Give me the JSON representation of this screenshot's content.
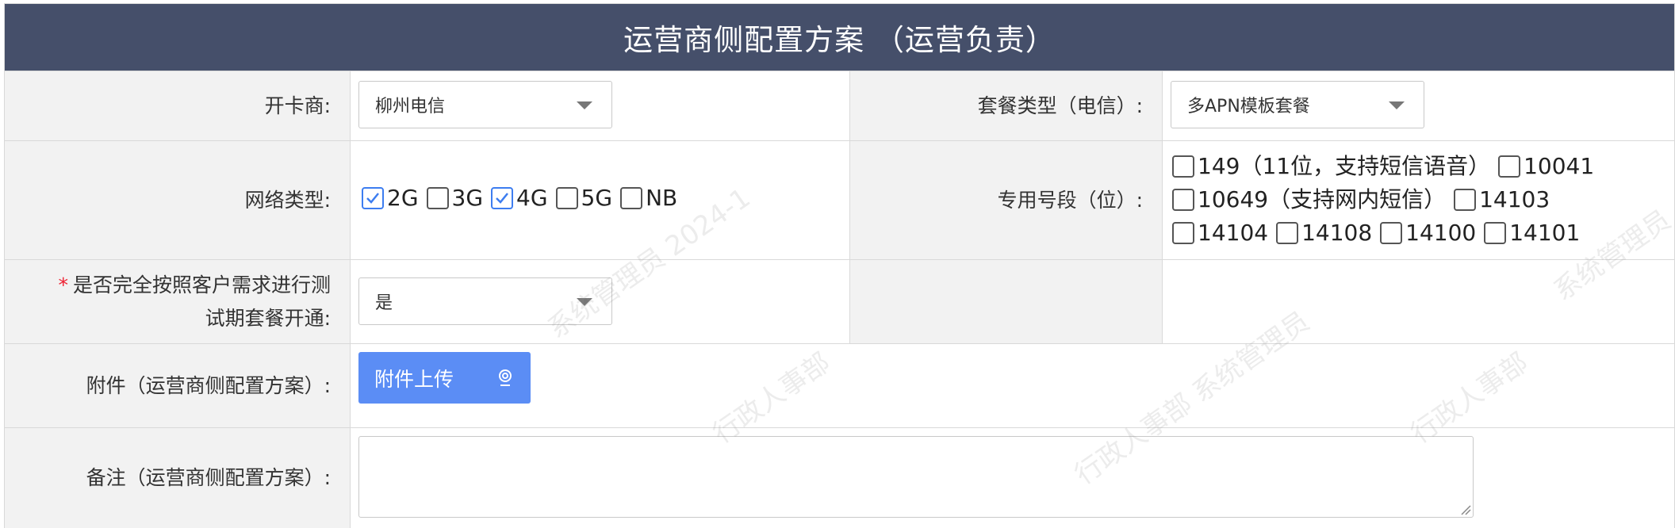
{
  "header": {
    "title": "运营商侧配置方案 （运营负责）"
  },
  "row1": {
    "card_vendor_label": "开卡商:",
    "card_vendor_value": "柳州电信",
    "plan_type_label": "套餐类型（电信）:",
    "plan_type_value": "多APN模板套餐"
  },
  "row2": {
    "network_label": "网络类型:",
    "networks": [
      {
        "label": "2G",
        "checked": true
      },
      {
        "label": "3G",
        "checked": false
      },
      {
        "label": "4G",
        "checked": true
      },
      {
        "label": "5G",
        "checked": false
      },
      {
        "label": "NB",
        "checked": false
      }
    ],
    "segment_label": "专用号段（位）:",
    "segments": [
      {
        "label": "149（11位，支持短信语音）",
        "checked": false
      },
      {
        "label": "10041",
        "checked": false
      },
      {
        "label": "10649（支持网内短信）",
        "checked": false
      },
      {
        "label": "14103",
        "checked": false
      },
      {
        "label": "14104",
        "checked": false
      },
      {
        "label": "14108",
        "checked": false
      },
      {
        "label": "14100",
        "checked": false
      },
      {
        "label": "14101",
        "checked": false
      }
    ]
  },
  "row3": {
    "required_mark": "*",
    "trial_label_line1": "是否完全按照客户需求进行测",
    "trial_label_line2": "试期套餐开通:",
    "trial_value": "是"
  },
  "row4": {
    "attachment_label": "附件（运营商侧配置方案）:",
    "upload_button": "附件上传"
  },
  "row5": {
    "remark_label": "备注（运营商侧配置方案）:",
    "remark_value": ""
  },
  "watermark": {
    "texts": [
      "行政人事部",
      "系统管理员",
      "行政人事部 系统管理员",
      "系统管理员 2024-1"
    ]
  },
  "colors": {
    "header_bg": "#454f6a",
    "label_bg": "#f2f2f2",
    "accent": "#5b8df5",
    "check": "#3d7df0",
    "required": "#e23333"
  }
}
